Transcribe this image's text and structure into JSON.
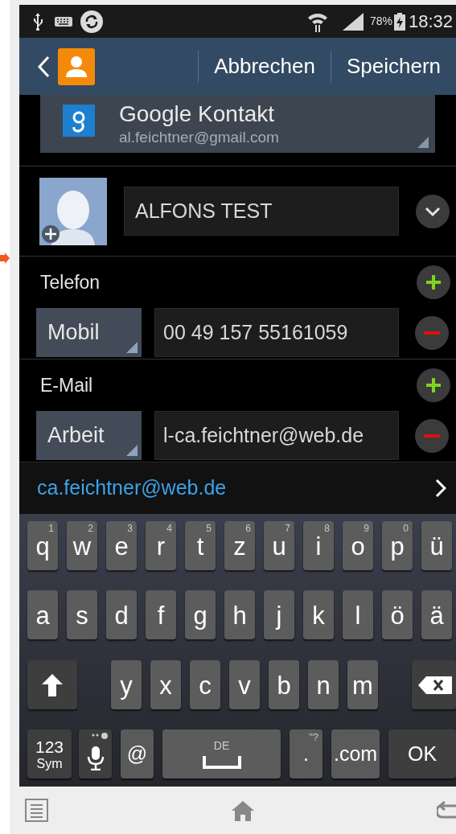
{
  "status_bar": {
    "battery": "78%",
    "time": "18:32"
  },
  "action_bar": {
    "buttons": [
      "Abbrechen",
      "Speichern"
    ]
  },
  "account": {
    "title": "Google Kontakt",
    "email": "al.feichtner@gmail.com"
  },
  "name_field": {
    "value": "ALFONS TEST"
  },
  "sections": [
    {
      "label": "Telefon",
      "type": "Mobil",
      "value": "00 49 157 55161059"
    },
    {
      "label": "E-Mail",
      "type": "Arbeit",
      "value": "l-ca.feichtner@web.de"
    }
  ],
  "suggestion": "ca.feichtner@web.de",
  "keyboard": {
    "rows": [
      {
        "keys": [
          {
            "kind": "letter",
            "label": "q",
            "hint": "1"
          },
          {
            "kind": "letter",
            "label": "w",
            "hint": "2"
          },
          {
            "kind": "letter",
            "label": "e",
            "hint": "3"
          },
          {
            "kind": "letter",
            "label": "r",
            "hint": "4"
          },
          {
            "kind": "letter",
            "label": "t",
            "hint": "5"
          },
          {
            "kind": "letter",
            "label": "z",
            "hint": "6"
          },
          {
            "kind": "letter",
            "label": "u",
            "hint": "7"
          },
          {
            "kind": "letter",
            "label": "i",
            "hint": "8"
          },
          {
            "kind": "letter",
            "label": "o",
            "hint": "9"
          },
          {
            "kind": "letter",
            "label": "p",
            "hint": "0"
          },
          {
            "kind": "letter",
            "label": "ü"
          }
        ]
      },
      {
        "keys": [
          {
            "kind": "letter",
            "label": "a"
          },
          {
            "kind": "letter",
            "label": "s"
          },
          {
            "kind": "letter",
            "label": "d"
          },
          {
            "kind": "letter",
            "label": "f"
          },
          {
            "kind": "letter",
            "label": "g"
          },
          {
            "kind": "letter",
            "label": "h"
          },
          {
            "kind": "letter",
            "label": "j"
          },
          {
            "kind": "letter",
            "label": "k"
          },
          {
            "kind": "letter",
            "label": "l"
          },
          {
            "kind": "letter",
            "label": "ö"
          },
          {
            "kind": "letter",
            "label": "ä"
          }
        ]
      },
      {
        "keys": [
          {
            "kind": "shift"
          },
          {
            "kind": "letter",
            "label": "y"
          },
          {
            "kind": "letter",
            "label": "x"
          },
          {
            "kind": "letter",
            "label": "c"
          },
          {
            "kind": "letter",
            "label": "v"
          },
          {
            "kind": "letter",
            "label": "b"
          },
          {
            "kind": "letter",
            "label": "n"
          },
          {
            "kind": "letter",
            "label": "m"
          },
          {
            "kind": "backspace"
          }
        ]
      },
      {
        "keys": [
          {
            "kind": "sym",
            "label": "123",
            "sub": "Sym"
          },
          {
            "kind": "mic"
          },
          {
            "kind": "key",
            "label": "@"
          },
          {
            "kind": "space",
            "hint": "DE"
          },
          {
            "kind": "key",
            "label": ".",
            "hint": "\"?"
          },
          {
            "kind": "key",
            "label": ".com"
          },
          {
            "kind": "function",
            "label": "OK"
          }
        ]
      }
    ]
  }
}
